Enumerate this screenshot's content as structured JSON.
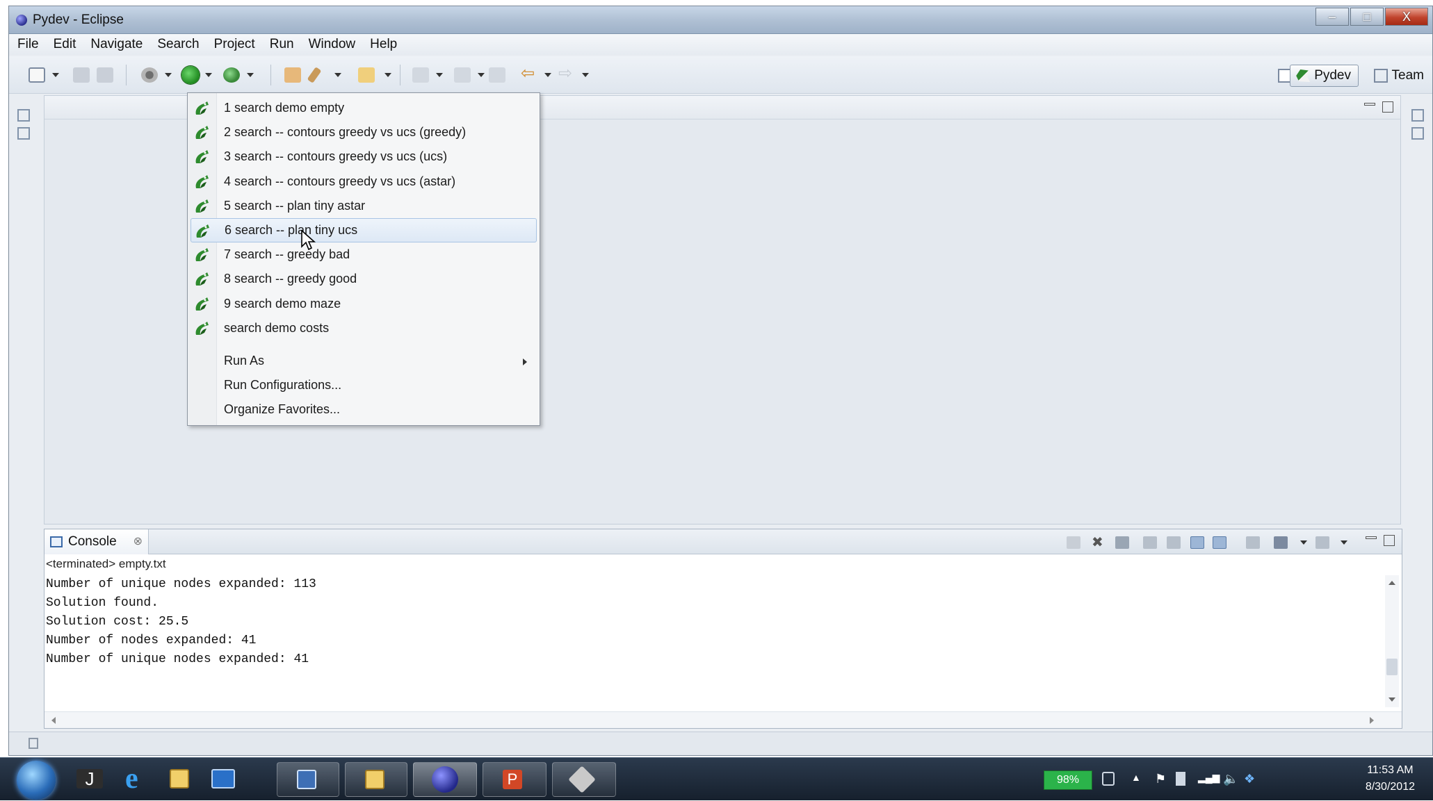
{
  "window": {
    "title": "Pydev - Eclipse",
    "minimize": "–",
    "maximize": "□",
    "close": "X"
  },
  "menubar": [
    "File",
    "Edit",
    "Navigate",
    "Search",
    "Project",
    "Run",
    "Window",
    "Help"
  ],
  "perspectives": {
    "pydev": "Pydev",
    "team": "Team"
  },
  "run_menu": {
    "favorites": [
      "1 search demo empty",
      "2 search -- contours greedy vs ucs (greedy)",
      "3 search -- contours greedy vs ucs (ucs)",
      "4 search -- contours greedy vs ucs (astar)",
      "5 search -- plan tiny astar",
      "6 search -- plan tiny ucs",
      "7 search -- greedy bad",
      "8 search -- greedy good",
      "9 search demo maze",
      "search demo costs"
    ],
    "highlighted_index": 5,
    "run_as": "Run As",
    "run_configurations": "Run Configurations...",
    "organize_favorites": "Organize Favorites..."
  },
  "console": {
    "tab_label": "Console",
    "tab_close": "⊗",
    "description": "<terminated> empty.txt",
    "lines": [
      "Number of unique nodes expanded: 113",
      "Solution found.",
      "Solution cost: 25.5",
      "Number of nodes expanded: 41",
      "Number of unique nodes expanded: 41"
    ]
  },
  "taskbar": {
    "battery": "98%",
    "time": "11:53 AM",
    "date": "8/30/2012"
  },
  "colors": {
    "run_green": "#1f8a1f",
    "menu_highlight": "#dde8f5",
    "taskbar": "#1d2a3a",
    "battery_green": "#2bb34a"
  }
}
